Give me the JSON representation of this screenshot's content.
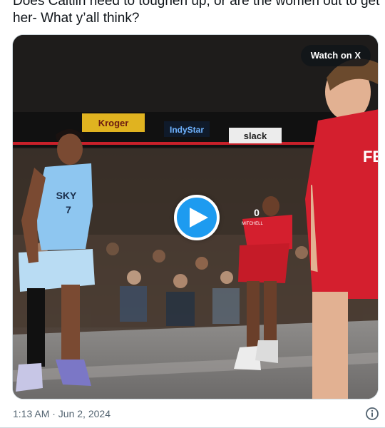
{
  "tweet": {
    "text": "Does Caitlin need to toughen up, or are the women out to get her- What y’all think?",
    "timestamp": "1:13 AM · Jun 2, 2024"
  },
  "media": {
    "watch_label": "Watch on X",
    "jersey_left_team": "SKY",
    "jersey_left_number": "7",
    "jersey_center_number": "0",
    "jersey_center_name": "MITCHELL",
    "jersey_right_letters": "FE",
    "banner_1": "Kroger",
    "banner_2": "IndyStar",
    "banner_3": "slack",
    "play_icon": "play-icon"
  },
  "colors": {
    "accent": "#1d9bf0",
    "text_primary": "#0f1419",
    "text_secondary": "#536471",
    "border": "#cfd9de",
    "fever_red": "#d41f2e",
    "sky_blue": "#8ec6f0"
  },
  "icons": {
    "info": "info-icon"
  }
}
